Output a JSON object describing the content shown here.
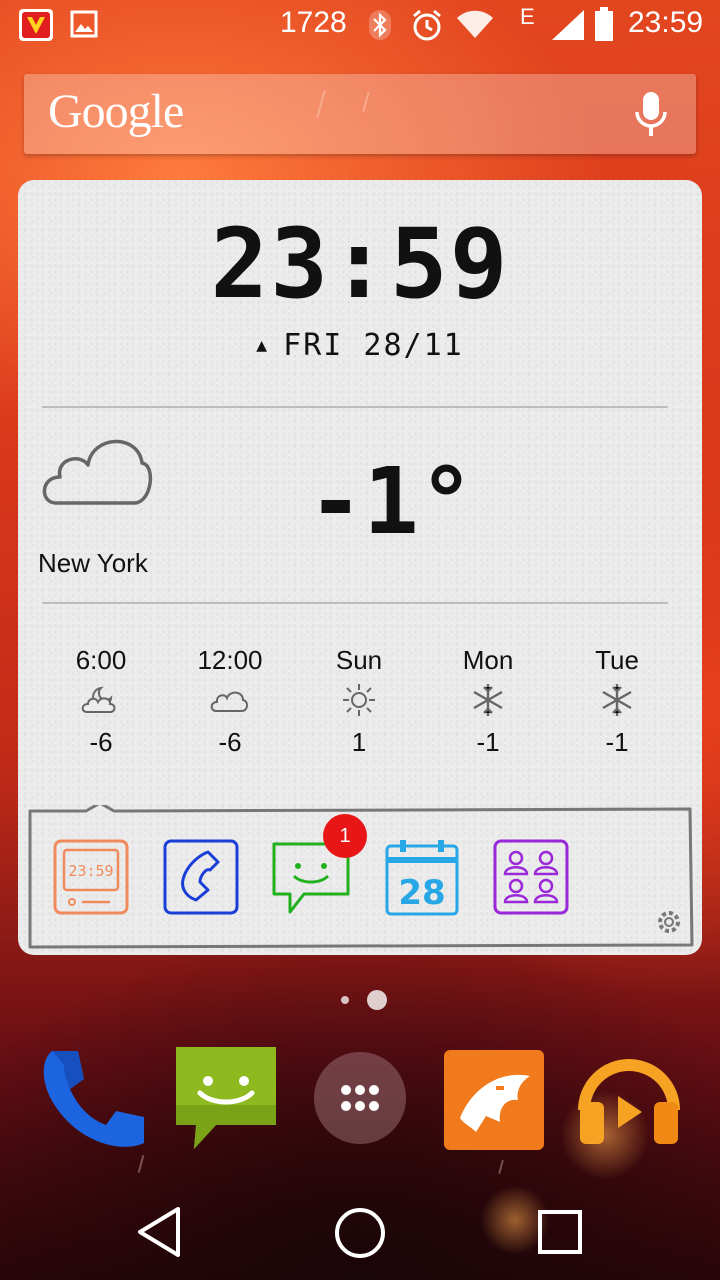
{
  "status_bar": {
    "notification_count": "1728",
    "network_type": "E",
    "time": "23:59"
  },
  "search": {
    "logo": "Google",
    "mic_icon": "mic-icon"
  },
  "clock_widget": {
    "time": "23:59",
    "date": "FRI 28/11",
    "alarm_icon": "alarm-icon",
    "city": "New York",
    "temperature": "-1°",
    "condition_icon": "cloud-icon",
    "forecast": [
      {
        "label": "6:00",
        "icon": "partly-cloudy-night-icon",
        "value": "-6"
      },
      {
        "label": "12:00",
        "icon": "cloud-icon",
        "value": "-6"
      },
      {
        "label": "Sun",
        "icon": "sun-icon",
        "value": "1"
      },
      {
        "label": "Mon",
        "icon": "snowflake-icon",
        "value": "-1"
      },
      {
        "label": "Tue",
        "icon": "snowflake-icon",
        "value": "-1"
      }
    ],
    "apps": [
      {
        "name": "clock-app-icon",
        "text": "23:59"
      },
      {
        "name": "phone-app-icon"
      },
      {
        "name": "messages-app-icon"
      },
      {
        "name": "calendar-app-icon",
        "text": "28"
      },
      {
        "name": "contacts-app-icon"
      }
    ],
    "messages_badge": "1",
    "settings_icon": "gear-icon"
  },
  "home": {
    "pages": 2,
    "current_page": 2
  },
  "dock": [
    {
      "name": "phone-icon"
    },
    {
      "name": "messaging-icon"
    },
    {
      "name": "app-drawer-icon"
    },
    {
      "name": "cm-browser-icon"
    },
    {
      "name": "play-music-icon"
    }
  ],
  "nav_bar": [
    "back-button",
    "home-button",
    "recents-button"
  ],
  "colors": {
    "widget_bg": "#ececec",
    "badge": "#e81616",
    "clock_app": "#f08a5d",
    "phone_app": "#1a3fd8",
    "messages_app": "#22b01e",
    "calendar_app": "#27a7e6",
    "contacts_app": "#9a27d8"
  }
}
